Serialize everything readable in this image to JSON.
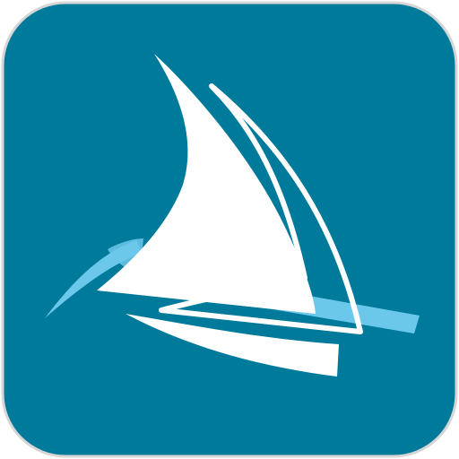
{
  "icon": {
    "name": "sailboat-icon",
    "colors": {
      "page_background": "#ffffff",
      "tile_background": "#007a9b",
      "tile_border": "#d6d6d6",
      "sail": "#ffffff",
      "water_wave": "#6cc8ea"
    }
  }
}
